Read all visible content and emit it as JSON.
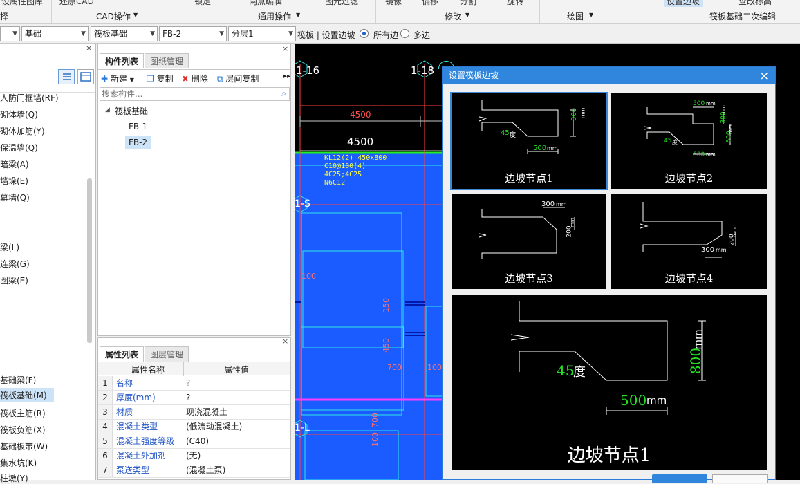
{
  "ribbon": {
    "cut_labels": [
      "设属性图库",
      "还原CAD",
      "锁定",
      "两点编辑",
      "图元过滤",
      "镜像",
      "偏移",
      "分割",
      "旋转",
      "设置边坡",
      "查改标高"
    ],
    "groups": [
      "择",
      "CAD操作",
      "通用操作",
      "修改",
      "绘图",
      "筏板基础二次编辑"
    ]
  },
  "toolbar": {
    "combo1": "",
    "combo2": "基础",
    "combo3": "筏板基础",
    "combo4": "FB-2",
    "combo5": "分层1",
    "text": "筏板 | 设置边坡",
    "radio1": "所有边",
    "radio2": "多边"
  },
  "left_panel": {
    "items": [
      "人防门框墙(RF)",
      "砌体墙(Q)",
      "砌体加筋(Y)",
      "保温墙(Q)",
      "暗梁(A)",
      "墙垛(E)",
      "幕墙(Q)",
      "梁(L)",
      "连梁(G)",
      "圈梁(E)",
      "基础梁(F)",
      "筏板基础(M)",
      "筏板主筋(R)",
      "筏板负筋(X)",
      "基础板带(W)",
      "集水坑(K)",
      "柱墩(Y)"
    ]
  },
  "component_panel": {
    "tabs": [
      "构件列表",
      "图纸管理"
    ],
    "new_label": "新建",
    "copy_label": "复制",
    "delete_label": "删除",
    "floor_copy_label": "层间复制",
    "search_placeholder": "搜索构件...",
    "tree_root": "筏板基础",
    "tree_items": [
      "FB-1",
      "FB-2"
    ]
  },
  "property_panel": {
    "tabs": [
      "属性列表",
      "图层管理"
    ],
    "col_name": "属性名称",
    "col_value": "属性值",
    "rows": [
      {
        "n": "1",
        "name": "名称",
        "value": "?"
      },
      {
        "n": "2",
        "name": "厚度(mm)",
        "value": "?"
      },
      {
        "n": "3",
        "name": "材质",
        "value": "现浇混凝土"
      },
      {
        "n": "4",
        "name": "混凝土类型",
        "value": "(低流动混凝土)"
      },
      {
        "n": "5",
        "name": "混凝土强度等级",
        "value": "(C40)"
      },
      {
        "n": "6",
        "name": "混凝土外加剂",
        "value": "(无)"
      },
      {
        "n": "7",
        "name": "泵送类型",
        "value": "(混凝土泵)"
      }
    ]
  },
  "canvas": {
    "axis1": "1-16",
    "axis2": "1-18",
    "axis3": "1-S",
    "axis4": "1-L",
    "dim_small": "4500",
    "dim_big": "4500",
    "beam_text": [
      "KL12(2) 450x800",
      "C10@100(4)",
      "4C25;4C25",
      "N6C12"
    ],
    "dims_red": [
      "100",
      "150",
      "450",
      "700",
      "100",
      "700",
      "100"
    ]
  },
  "dialog": {
    "title": "设置筏板边坡",
    "close": "×",
    "nodes": [
      {
        "caption": "边坡节点1",
        "dims": [
          "800",
          "mm",
          "45",
          "度",
          "500",
          "mm"
        ]
      },
      {
        "caption": "边坡节点2",
        "dims": [
          "500",
          "mm",
          "300",
          "mm",
          "600",
          "mm",
          "45",
          "度",
          "600",
          "mm"
        ]
      },
      {
        "caption": "边坡节点3",
        "dims": [
          "300",
          "mm",
          "200",
          "mm"
        ]
      },
      {
        "caption": "边坡节点4",
        "dims": [
          "200",
          "mm",
          "300",
          "mm"
        ]
      }
    ],
    "preview": {
      "caption": "边坡节点1",
      "angle": "45",
      "angle_unit": "度",
      "height": "800",
      "height_unit": "mm",
      "width": "500",
      "width_unit": "mm"
    }
  },
  "colors": {
    "canvas_bg": "#000000",
    "slab_blue": "#1a5cff",
    "dialog_title": "#2f86dc",
    "dim_green": "#22dd22"
  }
}
